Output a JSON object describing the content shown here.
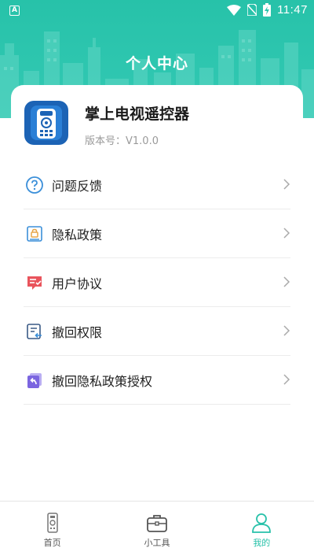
{
  "status_bar": {
    "time": "11:47",
    "app_indicator": "A"
  },
  "header": {
    "title": "个人中心"
  },
  "profile": {
    "app_name": "掌上电视遥控器",
    "version": "版本号：V1.0.0",
    "logo_icon": "tv-remote-icon"
  },
  "menu": {
    "items": [
      {
        "label": "问题反馈",
        "icon": "question-circle-icon"
      },
      {
        "label": "隐私政策",
        "icon": "privacy-lock-icon"
      },
      {
        "label": "用户协议",
        "icon": "user-agreement-icon"
      },
      {
        "label": "撤回权限",
        "icon": "revoke-permission-icon"
      },
      {
        "label": "撤回隐私政策授权",
        "icon": "revoke-privacy-icon"
      }
    ]
  },
  "tabbar": {
    "tabs": [
      {
        "label": "首页",
        "icon": "remote-icon",
        "active": false
      },
      {
        "label": "小工具",
        "icon": "toolbox-icon",
        "active": false
      },
      {
        "label": "我的",
        "icon": "person-icon",
        "active": true
      }
    ]
  },
  "colors": {
    "accent": "#28c1a9",
    "header": "#2ec4ad",
    "logo_bg": "#1c63b5"
  }
}
